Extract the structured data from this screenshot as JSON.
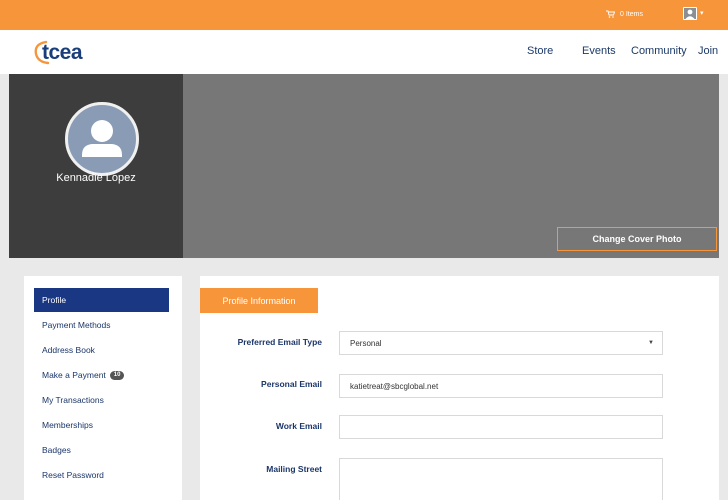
{
  "topbar": {
    "cart_label": "0 Items",
    "cart_icon": "cart-icon",
    "user_icon": "user-icon",
    "caret_icon": "caret-down-icon",
    "color": "#f7953b"
  },
  "brand": {
    "logo_text": "tcea",
    "color": "#1a3e7a"
  },
  "nav": {
    "links": [
      "Store",
      "Events",
      "Community",
      "Join"
    ]
  },
  "profile": {
    "name": "Kennadie Lopez",
    "cover_button": "Change Cover Photo",
    "avatar_icon": "avatar-placeholder-icon"
  },
  "sidebar": {
    "items": [
      {
        "label": "Profile",
        "active": true
      },
      {
        "label": "Payment Methods"
      },
      {
        "label": "Address Book"
      },
      {
        "label": "Make a Payment",
        "badge": "10"
      },
      {
        "label": "My Transactions"
      },
      {
        "label": "Memberships"
      },
      {
        "label": "Badges"
      },
      {
        "label": "Reset Password"
      }
    ],
    "active_color": "#1a3784"
  },
  "form": {
    "tab_label": "Profile Information",
    "fields": [
      {
        "label": "Preferred Email Type",
        "value": "Personal",
        "type": "select"
      },
      {
        "label": "Personal Email",
        "value": "katietreat@sbcglobal.net",
        "type": "text"
      },
      {
        "label": "Work Email",
        "value": "",
        "type": "text"
      },
      {
        "label": "Mailing Street",
        "value": "",
        "type": "textarea"
      }
    ]
  }
}
